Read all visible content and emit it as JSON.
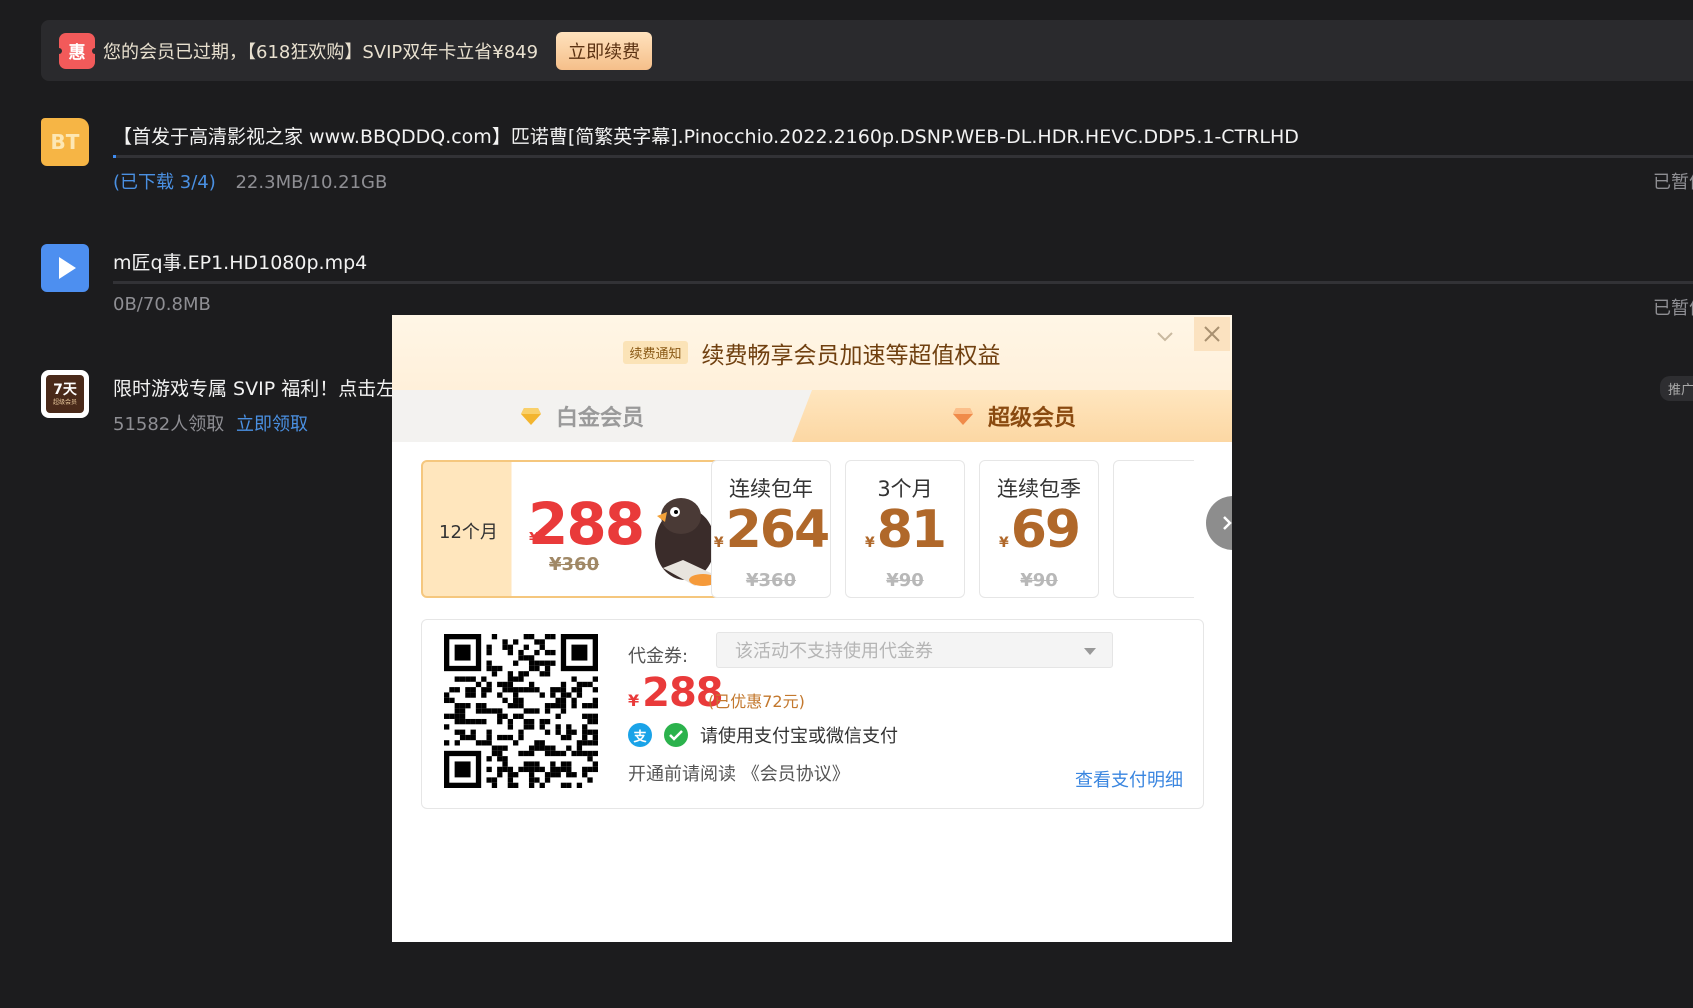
{
  "banner": {
    "badge": "惠",
    "text": "您的会员已过期，【618狂欢购】SVIP双年卡立省¥849",
    "button": "立即续费"
  },
  "downloads": [
    {
      "icon": "BT",
      "name": "【首发于高清影视之家 www.BBQDDQ.com】匹诺曹[简繁英字幕].Pinocchio.2022.2160p.DSNP.WEB-DL.HDR.HEVC.DDP5.1-CTRLHD",
      "progress_label": "(已下载 3/4)",
      "size": "22.3MB/10.21GB",
      "progress": 0.002,
      "status": "已暂停"
    },
    {
      "icon": "play-icon",
      "name": "m匠q事.EP1.HD1080p.mp4",
      "size": "0B/70.8MB",
      "progress": 0,
      "status": "已暂停"
    },
    {
      "icon_title": "7天",
      "icon_sub": "超级会员",
      "name": "限时游戏专属 SVIP 福利！点击左",
      "claimed": "51582人领取",
      "claim_link": "立即领取",
      "tag": "推广"
    }
  ],
  "modal": {
    "notice_tag": "续费通知",
    "title": "续费畅享会员加速等超值权益",
    "tabs": {
      "platinum": "白金会员",
      "super": "超级会员"
    },
    "plans": [
      {
        "period": "12个月",
        "yen": "¥",
        "price": "288",
        "original": "¥360"
      },
      {
        "title": "连续包年",
        "yen": "¥",
        "price": "264",
        "original": "¥360"
      },
      {
        "title": "3个月",
        "yen": "¥",
        "price": "81",
        "original": "¥90"
      },
      {
        "title": "连续包季",
        "yen": "¥",
        "price": "69",
        "original": "¥90"
      }
    ],
    "payment": {
      "coupon_label": "代金券:",
      "coupon_placeholder": "该活动不支持使用代金券",
      "yen": "¥",
      "price": "288",
      "discount": "(已优惠72元)",
      "method_text": "请使用支付宝或微信支付",
      "agreement": "开通前请阅读 《会员协议》",
      "detail_link": "查看支付明细"
    }
  },
  "colors": {
    "background": "#1c1c1e",
    "accent_red": "#e93a3a",
    "accent_gold": "#f5c77e",
    "link_blue": "#3a86e0"
  }
}
